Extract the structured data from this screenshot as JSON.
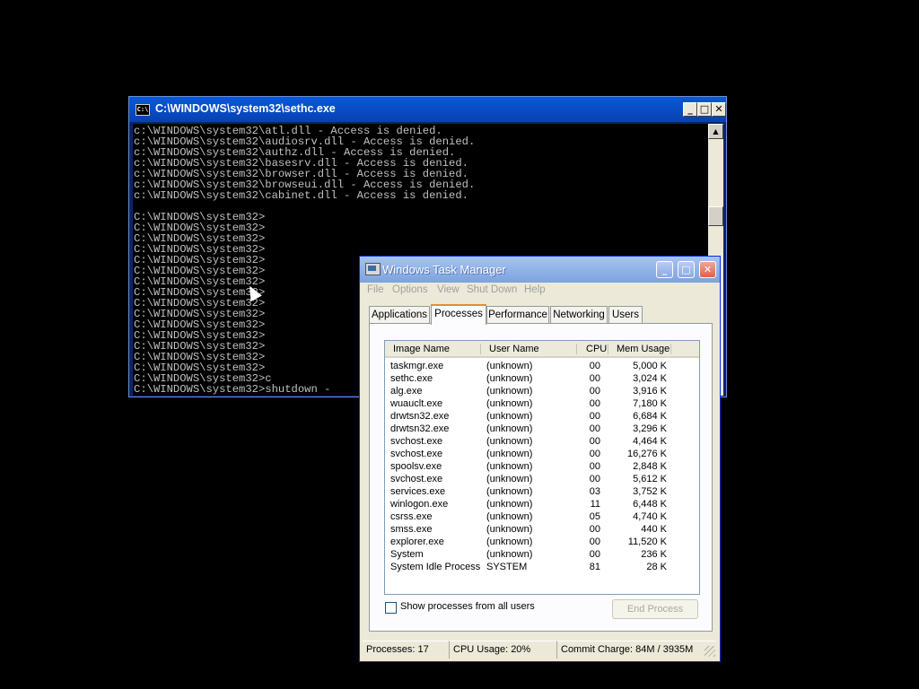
{
  "cmd": {
    "title": "C:\\WINDOWS\\system32\\sethc.exe",
    "icon": "cmd-icon",
    "lines": [
      "c:\\WINDOWS\\system32\\atl.dll - Access is denied.",
      "c:\\WINDOWS\\system32\\audiosrv.dll - Access is denied.",
      "c:\\WINDOWS\\system32\\authz.dll - Access is denied.",
      "c:\\WINDOWS\\system32\\basesrv.dll - Access is denied.",
      "c:\\WINDOWS\\system32\\browser.dll - Access is denied.",
      "c:\\WINDOWS\\system32\\browseui.dll - Access is denied.",
      "c:\\WINDOWS\\system32\\cabinet.dll - Access is denied.",
      "",
      "C:\\WINDOWS\\system32>",
      "C:\\WINDOWS\\system32>",
      "C:\\WINDOWS\\system32>",
      "C:\\WINDOWS\\system32>",
      "C:\\WINDOWS\\system32>",
      "C:\\WINDOWS\\system32>",
      "C:\\WINDOWS\\system32>",
      "C:\\WINDOWS\\system32>",
      "C:\\WINDOWS\\system32>",
      "C:\\WINDOWS\\system32>",
      "C:\\WINDOWS\\system32>",
      "C:\\WINDOWS\\system32>",
      "C:\\WINDOWS\\system32>",
      "C:\\WINDOWS\\system32>",
      "C:\\WINDOWS\\system32>",
      "C:\\WINDOWS\\system32>c",
      "C:\\WINDOWS\\system32>shutdown -"
    ],
    "buttons": {
      "minimize": "_",
      "maximize": "□",
      "close": "✕"
    }
  },
  "taskmgr": {
    "title": "Windows Task Manager",
    "buttons": {
      "minimize": "_",
      "maximize": "□",
      "close": "✕"
    },
    "menu": [
      "File",
      "Options",
      "View",
      "Shut Down",
      "Help"
    ],
    "tabs": [
      "Applications",
      "Processes",
      "Performance",
      "Networking",
      "Users"
    ],
    "active_tab": "Processes",
    "columns": [
      "Image Name",
      "User Name",
      "CPU",
      "Mem Usage"
    ],
    "processes": [
      {
        "name": "taskmgr.exe",
        "user": "(unknown)",
        "cpu": "00",
        "mem": "5,000 K"
      },
      {
        "name": "sethc.exe",
        "user": "(unknown)",
        "cpu": "00",
        "mem": "3,024 K"
      },
      {
        "name": "alg.exe",
        "user": "(unknown)",
        "cpu": "00",
        "mem": "3,916 K"
      },
      {
        "name": "wuauclt.exe",
        "user": "(unknown)",
        "cpu": "00",
        "mem": "7,180 K"
      },
      {
        "name": "drwtsn32.exe",
        "user": "(unknown)",
        "cpu": "00",
        "mem": "6,684 K"
      },
      {
        "name": "drwtsn32.exe",
        "user": "(unknown)",
        "cpu": "00",
        "mem": "3,296 K"
      },
      {
        "name": "svchost.exe",
        "user": "(unknown)",
        "cpu": "00",
        "mem": "4,464 K"
      },
      {
        "name": "svchost.exe",
        "user": "(unknown)",
        "cpu": "00",
        "mem": "16,276 K"
      },
      {
        "name": "spoolsv.exe",
        "user": "(unknown)",
        "cpu": "00",
        "mem": "2,848 K"
      },
      {
        "name": "svchost.exe",
        "user": "(unknown)",
        "cpu": "00",
        "mem": "5,612 K"
      },
      {
        "name": "services.exe",
        "user": "(unknown)",
        "cpu": "03",
        "mem": "3,752 K"
      },
      {
        "name": "winlogon.exe",
        "user": "(unknown)",
        "cpu": "11",
        "mem": "6,448 K"
      },
      {
        "name": "csrss.exe",
        "user": "(unknown)",
        "cpu": "05",
        "mem": "4,740 K"
      },
      {
        "name": "smss.exe",
        "user": "(unknown)",
        "cpu": "00",
        "mem": "440 K"
      },
      {
        "name": "explorer.exe",
        "user": "(unknown)",
        "cpu": "00",
        "mem": "11,520 K"
      },
      {
        "name": "System",
        "user": "(unknown)",
        "cpu": "00",
        "mem": "236 K"
      },
      {
        "name": "System Idle Process",
        "user": "SYSTEM",
        "cpu": "81",
        "mem": "28 K"
      }
    ],
    "show_all_label": "Show processes from all users",
    "show_all_checked": false,
    "end_process_label": "End Process",
    "status": {
      "processes": "Processes: 17",
      "cpu": "CPU Usage: 20%",
      "commit": "Commit Charge: 84M / 3935M"
    }
  }
}
